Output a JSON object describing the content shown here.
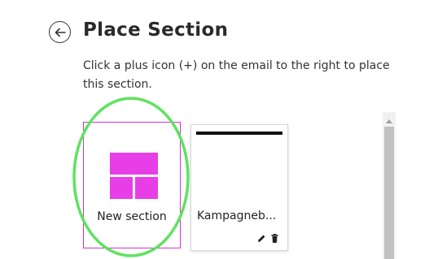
{
  "header": {
    "title": "Place Section",
    "back_icon": "arrow-left-icon"
  },
  "description": "Click a plus icon (+) on the email to the right to place this section.",
  "cards": {
    "new_section": {
      "label": "New section",
      "icon": "layout-grid-icon",
      "accent_color": "#e83ee8"
    },
    "template": {
      "label": "Kampagneb...",
      "edit_icon": "pencil-icon",
      "delete_icon": "trash-icon"
    }
  },
  "annotation": {
    "shape": "ellipse",
    "color": "#5ee35e"
  }
}
